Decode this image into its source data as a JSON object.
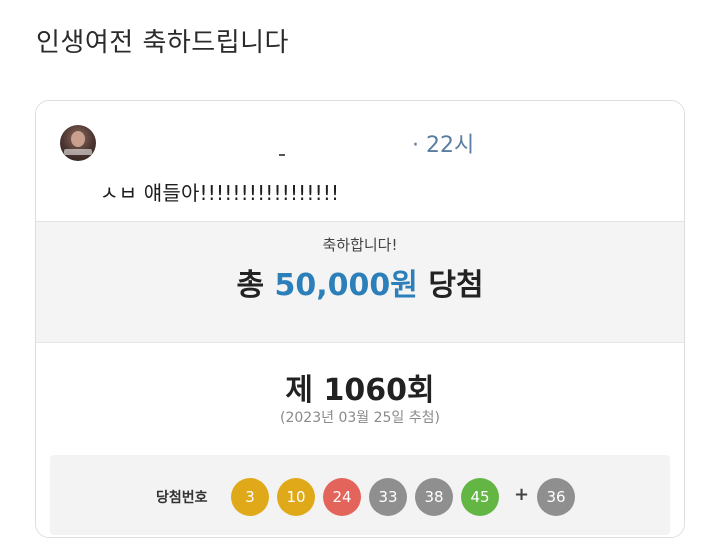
{
  "page": {
    "title": "인생여전 축하드립니다"
  },
  "post": {
    "time": "· 22시",
    "text": "ㅅㅂ 얘들아!!!!!!!!!!!!!!!!!"
  },
  "prize": {
    "congrats": "축하합니다!",
    "prefix": "총",
    "amount": "50,000원",
    "suffix": "당첨"
  },
  "draw": {
    "round": "제 1060회",
    "date": "(2023년 03월 25일 추첨)",
    "numbers_label": "당첨번호",
    "plus": "+",
    "balls": [
      {
        "value": "3",
        "color": "#e0a91a"
      },
      {
        "value": "10",
        "color": "#e0a91a"
      },
      {
        "value": "24",
        "color": "#e2645a"
      },
      {
        "value": "33",
        "color": "#8f8f8f"
      },
      {
        "value": "38",
        "color": "#8f8f8f"
      },
      {
        "value": "45",
        "color": "#63b544"
      }
    ],
    "bonus": {
      "value": "36",
      "color": "#8f8f8f"
    }
  }
}
